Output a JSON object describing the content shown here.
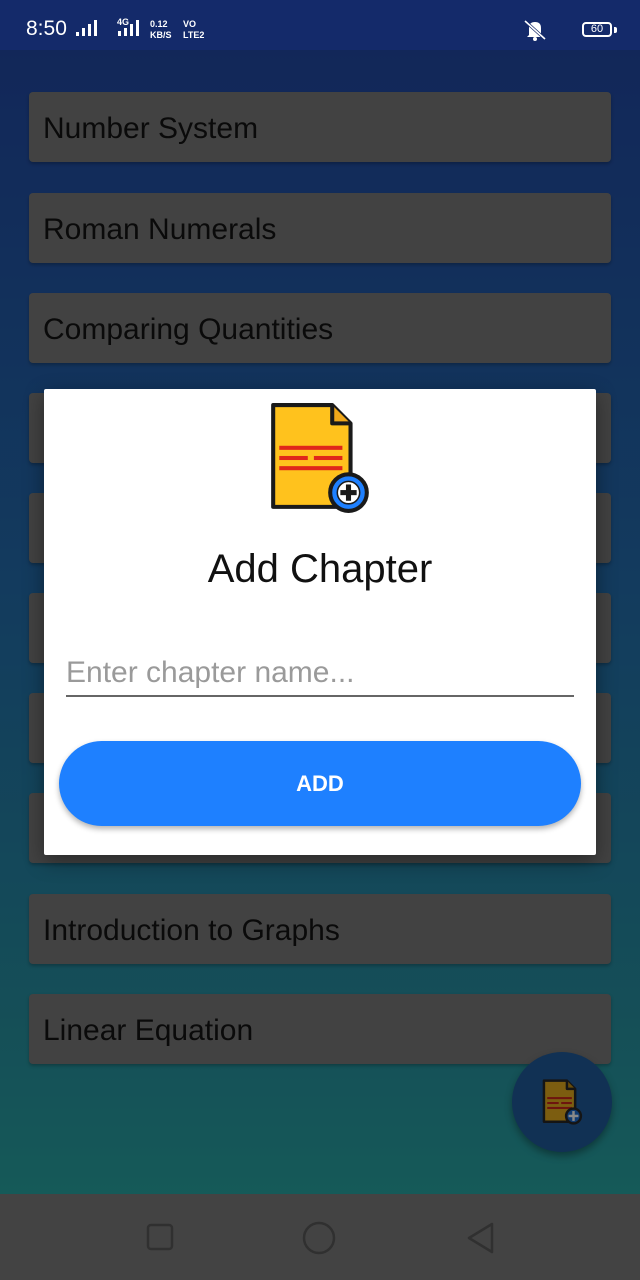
{
  "status_bar": {
    "time": "8:50",
    "net_speed_value": "0.12",
    "net_speed_unit": "KB/S",
    "network_type": "4G",
    "volte_top": "VO",
    "volte_bottom": "LTE2",
    "battery": "60"
  },
  "chapters": [
    {
      "label": "Number System"
    },
    {
      "label": "Roman Numerals"
    },
    {
      "label": "Comparing Quantities"
    },
    {
      "label": ""
    },
    {
      "label": ""
    },
    {
      "label": ""
    },
    {
      "label": ""
    },
    {
      "label": ""
    },
    {
      "label": "Introduction to Graphs"
    },
    {
      "label": "Linear Equation"
    }
  ],
  "dialog": {
    "icon": "document-add-icon",
    "title": "Add Chapter",
    "input_placeholder": "Enter chapter name...",
    "input_value": "",
    "add_button_label": "ADD"
  },
  "fab": {
    "icon": "document-add-icon"
  },
  "colors": {
    "list_item": "#6b6b6b",
    "accent": "#1e80ff",
    "document_fill": "#ffc21d",
    "document_lines": "#e0261a",
    "plus_badge": "#1e80ff"
  }
}
